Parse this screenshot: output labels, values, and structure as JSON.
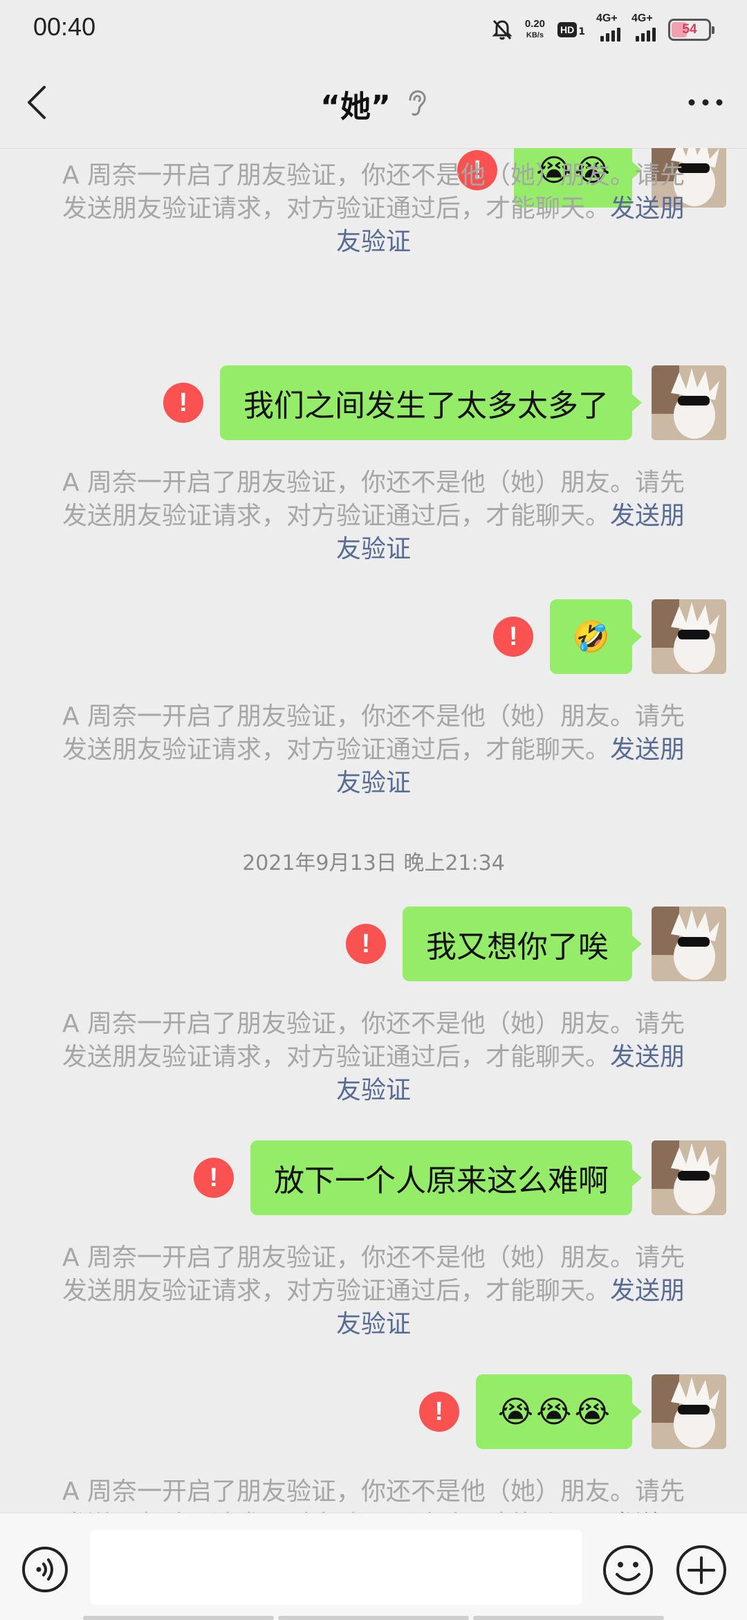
{
  "status": {
    "time": "00:40",
    "speed_value": "0.20",
    "speed_unit": "KB/s",
    "hd": "HD",
    "hd_sub": "1",
    "net1": "4G+",
    "net2": "4G+",
    "battery": "54"
  },
  "header": {
    "title": "“她”",
    "ear_icon": "ear-icon",
    "back_icon": "chevron-left-icon",
    "more_icon": "more-dots-icon"
  },
  "colors": {
    "bubble": "#95ec69",
    "error": "#fa5151",
    "link": "#576b95",
    "system_text": "#a6a6a6",
    "background": "#ededed"
  },
  "system_notice": {
    "text": "A 周奈一开启了朋友验证，你还不是他（她）朋友。请先发送朋友验证请求，对方验证通过后，才能聊天。",
    "link": "发送朋友验证"
  },
  "messages": [
    {
      "text": "",
      "emojis": [
        "😭",
        "😭"
      ],
      "status": "failed"
    },
    {
      "text": "我们之间发生了太多太多了",
      "emojis": [],
      "status": "failed"
    },
    {
      "text": "",
      "emojis": [
        "🤣"
      ],
      "status": "failed"
    },
    {
      "text": "我又想你了唉",
      "emojis": [],
      "status": "failed"
    },
    {
      "text": "放下一个人原来这么难啊",
      "emojis": [],
      "status": "failed"
    },
    {
      "text": "",
      "emojis": [
        "😭",
        "😭",
        "😭"
      ],
      "status": "failed"
    }
  ],
  "timestamp": "2021年9月13日 晚上21:34",
  "input": {
    "value": "",
    "voice_icon": "voice-icon",
    "emoji_icon": "emoji-icon",
    "plus_icon": "plus-icon"
  }
}
